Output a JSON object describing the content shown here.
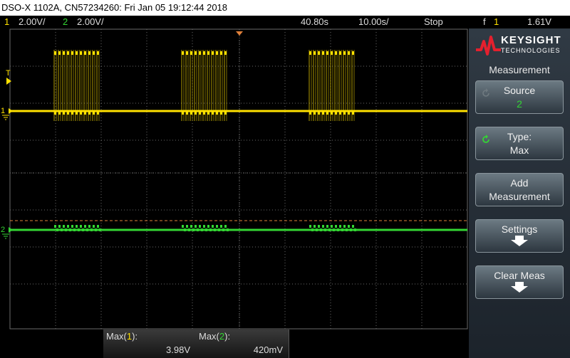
{
  "title_bar": "DSO-X 1102A, CN57234260: Fri Jan 05 19:12:44 2018",
  "status": {
    "ch1_num": "1",
    "ch1_scale": "2.00V/",
    "ch2_num": "2",
    "ch2_scale": "2.00V/",
    "delay": "40.80s",
    "timebase": "10.00s/",
    "run_state": "Stop",
    "trigger_icon": "f",
    "trigger_ch": "1",
    "trigger_level": "1.61V"
  },
  "screen": {
    "ch1_marker": "1",
    "ch2_marker": "2",
    "trigger_marker": "T"
  },
  "panel": {
    "brand": "KEYSIGHT",
    "brand_sub": "TECHNOLOGIES",
    "menu_title": "Measurement",
    "softkeys": {
      "source_label": "Source",
      "source_value": "2",
      "type_label": "Type:",
      "type_value": "Max",
      "add_line1": "Add",
      "add_line2": "Measurement",
      "settings_label": "Settings",
      "clear_label": "Clear Meas"
    }
  },
  "measurements": [
    {
      "label_prefix": "Max(",
      "channel": "1",
      "label_suffix": "):",
      "value": "3.98V"
    },
    {
      "label_prefix": "Max(",
      "channel": "2",
      "label_suffix": "):",
      "value": "420mV"
    }
  ],
  "colors": {
    "ch1": "#ffe100",
    "ch2": "#33d633",
    "grid": "#6a6a6a",
    "ref_line": "#e0803a"
  },
  "icons": {
    "logo": "keysight-wave-logo",
    "rotate": "rotate-knob-icon",
    "down": "arrow-down-icon"
  }
}
